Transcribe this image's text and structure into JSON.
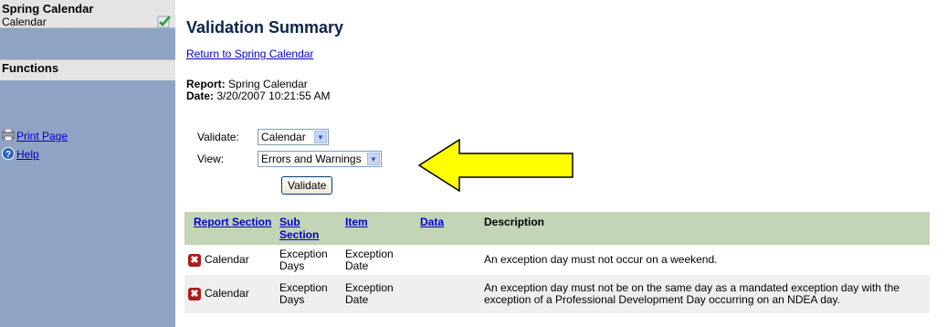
{
  "sidebar": {
    "title": "Spring Calendar",
    "item": "Calendar",
    "functions_label": "Functions",
    "links": [
      {
        "label": "Print Page",
        "icon": "printer-icon"
      },
      {
        "label": "Help",
        "icon": "help-icon"
      }
    ]
  },
  "main": {
    "title": "Validation Summary",
    "return_link": "Return to Spring Calendar",
    "report_label": "Report:",
    "report_value": "Spring Calendar",
    "date_label": "Date:",
    "date_value": "3/20/2007 10:21:55 AM",
    "form": {
      "validate_label": "Validate:",
      "validate_value": "Calendar",
      "view_label": "View:",
      "view_value": "Errors and Warnings",
      "button_label": "Validate"
    },
    "table": {
      "headers": [
        "Report Section",
        "Sub Section",
        "Item",
        "Data",
        "Description"
      ],
      "rows": [
        {
          "section": "Calendar",
          "sub": "Exception Days",
          "item": "Exception Date",
          "data": "",
          "desc": "An exception day must not occur on a weekend."
        },
        {
          "section": "Calendar",
          "sub": "Exception Days",
          "item": "Exception Date",
          "data": "",
          "desc": "An exception day must not be on the same day as a mandated exception day with the exception of a Professional Development Day occurring on an NDEA day."
        }
      ]
    }
  },
  "colors": {
    "sidebar_bg": "#8fa4c4",
    "header_bg": "#c3d4b7",
    "link": "#0000cc",
    "arrow_fill": "#ffff00"
  }
}
